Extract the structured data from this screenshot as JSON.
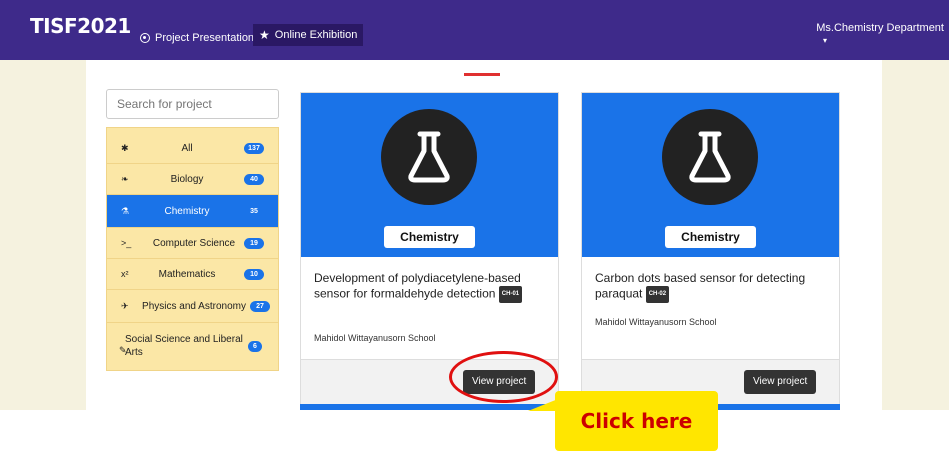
{
  "navbar": {
    "logo": "TISF2021",
    "items": [
      {
        "label": "Project Presentation",
        "icon": "dot-circle-icon"
      },
      {
        "label": "Online Exhibition",
        "icon": "star-icon"
      }
    ],
    "user": "Ms.Chemistry Department",
    "caret": "▾"
  },
  "sidebar": {
    "search_placeholder": "Search for project",
    "categories": [
      {
        "icon": "✱",
        "label": "All",
        "count": "137"
      },
      {
        "icon": "❧",
        "label": "Biology",
        "count": "40"
      },
      {
        "icon": "⚗",
        "label": "Chemistry",
        "count": "35"
      },
      {
        "icon": ">_",
        "label": "Computer Science",
        "count": "19"
      },
      {
        "icon": "x²",
        "label": "Mathematics",
        "count": "10"
      },
      {
        "icon": "✈",
        "label": "Physics and Astronomy",
        "count": "27"
      },
      {
        "icon": "✎",
        "label": "Social Science and Liberal Arts",
        "count": "6"
      }
    ]
  },
  "cards": [
    {
      "category": "Chemistry",
      "title": "Development of polydiacetylene-based sensor for formaldehyde detection",
      "code": "CH-01",
      "school": "Mahidol Wittayanusorn School",
      "button": "View project"
    },
    {
      "category": "Chemistry",
      "title": "Carbon dots based sensor for detecting paraquat",
      "code": "CH-02",
      "school": "Mahidol Wittayanusorn School",
      "button": "View project"
    }
  ],
  "callout": {
    "text": "Click here"
  },
  "colors": {
    "navbar": "#3e2a8a",
    "accent": "#1a73e8",
    "sidebar": "#fbe7a6",
    "callout": "#ffe600",
    "highlight": "#e01010"
  }
}
